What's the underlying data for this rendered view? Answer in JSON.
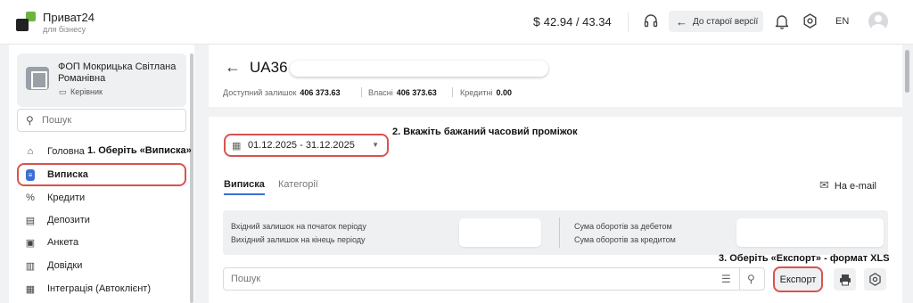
{
  "header": {
    "brand": "Приват24",
    "brand_sub": "для бізнесу",
    "rate": "42.94 / 43.34",
    "rate_symbol": "$",
    "old_version_label": "До старої версії",
    "lang": "EN"
  },
  "sidebar": {
    "company_name": "ФОП Мокрицька Світлана Романівна",
    "role": "Керівник",
    "search_placeholder": "Пошук",
    "items": [
      {
        "label": "Головна",
        "icon": "⌂"
      },
      {
        "label": "Виписка",
        "icon": "≡"
      },
      {
        "label": "Кредити",
        "icon": "%"
      },
      {
        "label": "Депозити",
        "icon": "▤"
      },
      {
        "label": "Анкета",
        "icon": "▣"
      },
      {
        "label": "Довідки",
        "icon": "▥"
      },
      {
        "label": "Інтеграція (Автоклієнт)",
        "icon": "▦"
      }
    ]
  },
  "annotations": {
    "step1": "1. Оберіть «Виписка»",
    "step2": "2. Вкажіть бажаний часовий проміжок",
    "step3": "3. Оберіть «Експорт» - формат XLS"
  },
  "account": {
    "iban_prefix": "UA36",
    "available_label": "Доступний залишок",
    "available_value": "406 373.63",
    "own_label": "Власні",
    "own_value": "406 373.63",
    "credit_label": "Кредитні",
    "credit_value": "0.00"
  },
  "statement": {
    "date_range": "01.12.2025 - 31.12.2025",
    "tabs": [
      "Виписка",
      "Категорії"
    ],
    "email_label": "На e-mail",
    "opening_balance_label": "Вхідний залишок на початок періоду",
    "closing_balance_label": "Вихідний залишок на кінець періоду",
    "debit_turnover_label": "Сума оборотів за дебетом",
    "credit_turnover_label": "Сума оборотів за кредитом",
    "search_placeholder": "Пошук",
    "export_label": "Експорт"
  },
  "colors": {
    "accent_blue": "#3b6fd6",
    "highlight_red": "#d9534f",
    "brand_green": "#6db33f"
  }
}
